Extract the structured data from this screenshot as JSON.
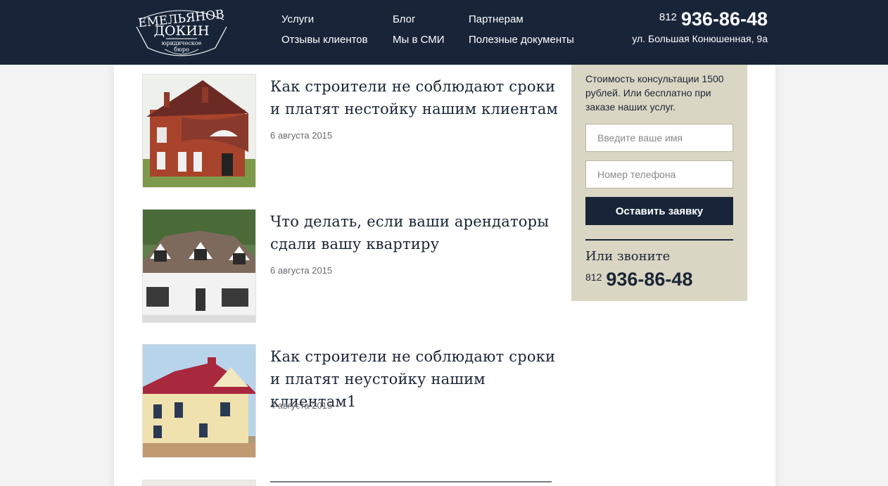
{
  "logo": {
    "line1": "ЕМЕЛЬЯНОВ",
    "line2": "ДОКИН",
    "line3": "юридическое",
    "line4": "бюро"
  },
  "nav": {
    "services": "Услуги",
    "reviews": "Отзывы клиентов",
    "blog": "Блог",
    "media": "Мы в СМИ",
    "partners": "Партнерам",
    "documents": "Полезные документы"
  },
  "header": {
    "phone_code": "812",
    "phone_number": "936-86-48",
    "address": "ул. Большая Конюшенная, 9а"
  },
  "articles": [
    {
      "title": "Как строители не соблюдают сроки и платят нестойку нашим клиентам",
      "date": "6 августа 2015"
    },
    {
      "title": "Что делать, если ваши арендаторы сдали вашу квартиру",
      "date": "6 августа 2015"
    },
    {
      "title": "Как строители не соблюдают сроки и платят неустойку нашим клиентам1",
      "date": "4 августа 2015"
    }
  ],
  "sidebar": {
    "text": "Стоимость консультации 1500 рублей. Или бесплатно при заказе наших услуг.",
    "name_placeholder": "Введите ваше имя",
    "phone_placeholder": "Номер телефона",
    "submit_label": "Оставить заявку",
    "call_label": "Или звоните",
    "phone_code": "812",
    "phone_number": "936-86-48"
  },
  "colors": {
    "header_bg": "#182539",
    "sidebar_bg": "#dad6c4",
    "button_bg": "#182539"
  }
}
